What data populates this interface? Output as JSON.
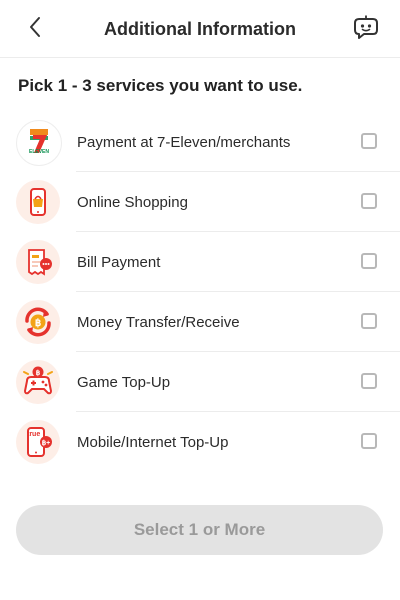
{
  "header": {
    "title": "Additional Information",
    "back_icon": "chevron-left-icon",
    "chat_icon": "chatbot-icon"
  },
  "prompt": "Pick 1 - 3 services you want to use.",
  "services": [
    {
      "label": "Payment at 7-Eleven/merchants",
      "icon": "seven-eleven-logo-icon",
      "checked": false,
      "logo_text": "ELEVEN"
    },
    {
      "label": "Online Shopping",
      "icon": "online-shopping-icon",
      "checked": false
    },
    {
      "label": "Bill Payment",
      "icon": "bill-payment-icon",
      "checked": false
    },
    {
      "label": "Money Transfer/Receive",
      "icon": "money-transfer-icon",
      "checked": false
    },
    {
      "label": "Game Top-Up",
      "icon": "game-topup-icon",
      "checked": false
    },
    {
      "label": "Mobile/Internet Top-Up",
      "icon": "mobile-topup-icon",
      "checked": false,
      "logo_text": "true"
    }
  ],
  "cta_label": "Select 1 or More",
  "colors": {
    "accent": "#e5322d",
    "icon_bg": "#fdeee7",
    "button_disabled_bg": "#e3e3e3",
    "button_disabled_text": "#9a9a9a"
  }
}
